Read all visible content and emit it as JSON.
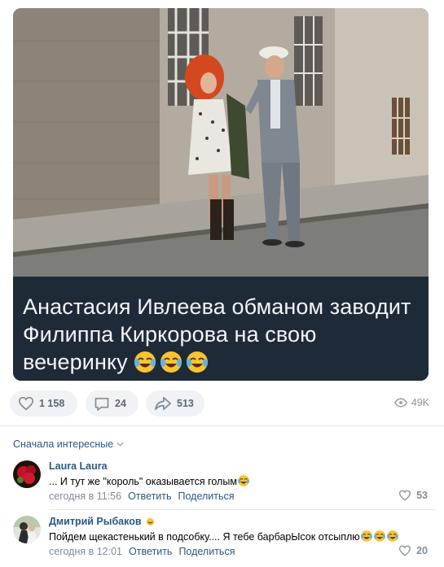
{
  "post": {
    "caption": "Анастасия Ивлеева обманом заводит Филиппа Киркорова на свою вечеринку",
    "caption_emojis": [
      "rofl-emoji",
      "rofl-emoji",
      "rofl-emoji"
    ],
    "likes": "1 158",
    "comments": "24",
    "shares": "513",
    "views": "49K"
  },
  "sort": {
    "label": "Сначала интересные"
  },
  "comments": [
    {
      "author": "Laura Laura",
      "text": "... И тут же \"король\" оказывается голым",
      "time": "сегодня в 11:56",
      "reply": "Ответить",
      "share": "Поделиться",
      "likes": "53"
    },
    {
      "author": "Дмитрий Рыбаков",
      "text": "Пойдем щекастенький в подсобку.... Я тебе барбарЫсок отсыплю",
      "time": "сегодня в 12:01",
      "reply": "Ответить",
      "share": "Поделиться",
      "likes": "20"
    }
  ],
  "colors": {
    "link": "#2a5885",
    "muted": "#818c99",
    "caption_bg": "#1f2a38",
    "pill_bg": "#f0f2f5"
  }
}
